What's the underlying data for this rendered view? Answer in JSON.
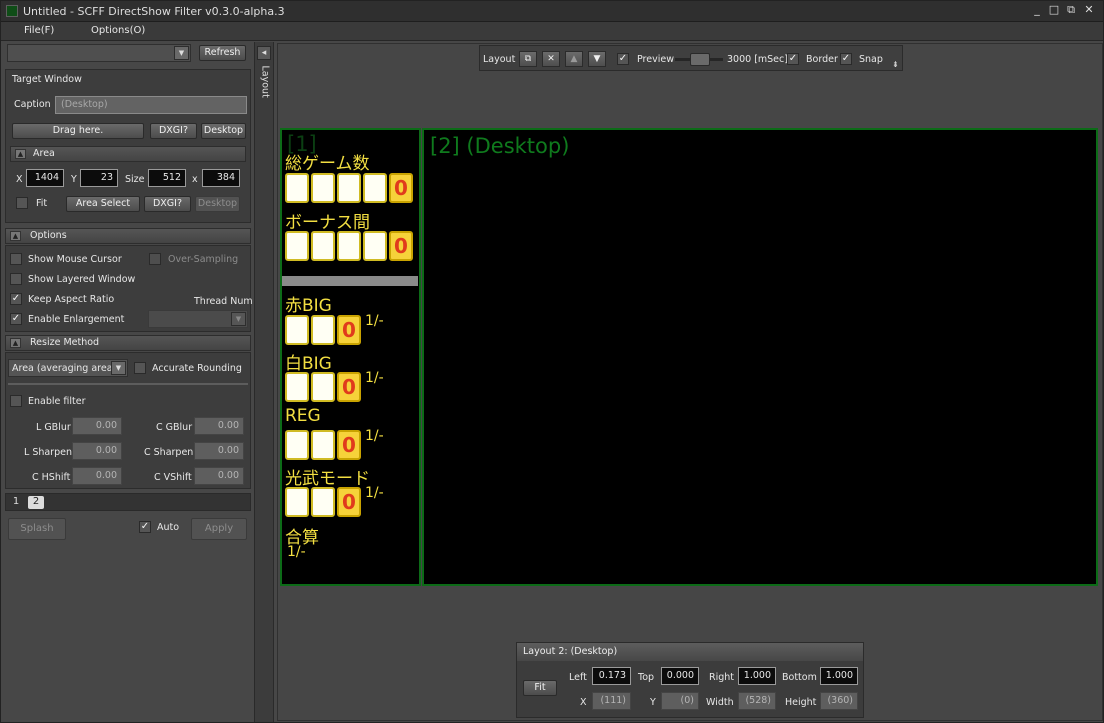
{
  "window": {
    "title": "Untitled - SCFF DirectShow Filter v0.3.0-alpha.3",
    "controls": [
      "_",
      "□",
      "⧉",
      "✕"
    ]
  },
  "menu": [
    "File(F)",
    "Options(O)"
  ],
  "process_bar": {
    "refresh": "Refresh"
  },
  "target_window": {
    "header": "Target Window",
    "caption_label": "Caption",
    "caption_value": "(Desktop)",
    "drag": "Drag here.",
    "dxgi": "DXGI?",
    "desktop": "Desktop"
  },
  "area": {
    "header": "Area",
    "x_label": "X",
    "x": "1404",
    "y_label": "Y",
    "y": "23",
    "size_label": "Size",
    "w": "512",
    "x_sep": "x",
    "h": "384",
    "fit": "Fit",
    "area_select": "Area Select",
    "dxgi": "DXGI?",
    "desktop": "Desktop"
  },
  "options": {
    "header": "Options",
    "show_mouse_cursor": "Show Mouse Cursor",
    "over_sampling": "Over-Sampling",
    "show_layered_window": "Show Layered Window",
    "keep_aspect_ratio": "Keep Aspect Ratio",
    "thread_num": "Thread Num",
    "enable_enlargement": "Enable Enlargement"
  },
  "resize": {
    "header": "Resize Method",
    "method": "Area (averaging area)",
    "accurate_rounding": "Accurate Rounding",
    "enable_filter": "Enable filter",
    "l_gblur": "L GBlur",
    "l_gblur_v": "0.00",
    "c_gblur": "C GBlur",
    "c_gblur_v": "0.00",
    "l_sharpen": "L Sharpen",
    "l_sharpen_v": "0.00",
    "c_sharpen": "C Sharpen",
    "c_sharpen_v": "0.00",
    "c_hshift": "C HShift",
    "c_hshift_v": "0.00",
    "c_vshift": "C VShift",
    "c_vshift_v": "0.00"
  },
  "tabs": [
    "1",
    "2"
  ],
  "bottom": {
    "splash": "Splash",
    "auto": "Auto",
    "apply": "Apply"
  },
  "side": {
    "layout": "Layout",
    "arrow": "◂"
  },
  "toolbar": {
    "layout": "Layout",
    "preview": "Preview",
    "ms": "3000 [mSec]",
    "border": "Border",
    "snap": "Snap",
    "more": "⇟"
  },
  "preview": {
    "slider_level": 0.55,
    "layout1": {
      "title": "[1]",
      "t1": "総ゲーム数",
      "t2": "ボーナス間",
      "t3": "赤BIG",
      "t4": "白BIG",
      "t5": "REG",
      "t6": "光武モード",
      "t7": "合算",
      "t7b": "1/-",
      "digit": "0",
      "ratio": "1/-"
    },
    "layout2": {
      "title": "[2] (Desktop)"
    }
  },
  "layout_panel": {
    "header": "Layout 2: (Desktop)",
    "fit": "Fit",
    "left_label": "Left",
    "left": "0.173",
    "top_label": "Top",
    "top": "0.000",
    "right_label": "Right",
    "right": "1.000",
    "bottom_label": "Bottom",
    "bottom": "1.000",
    "x_label": "X",
    "x": "(111)",
    "y_label": "Y",
    "y": "(0)",
    "w_label": "Width",
    "w": "(528)",
    "h_label": "Height",
    "h": "(360)"
  }
}
